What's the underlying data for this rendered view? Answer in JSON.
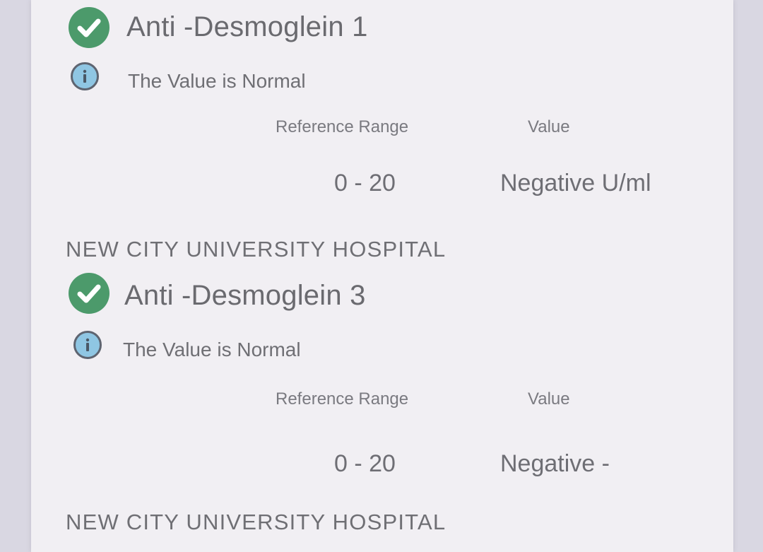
{
  "results": [
    {
      "test_name": "Anti -Desmoglein 1",
      "status_text": "The Value is Normal",
      "reference_range_header": "Reference Range",
      "value_header": "Value",
      "reference_range": "0 - 20",
      "value": "Negative U/ml",
      "lab_name": "NEW CITY UNIVERSITY HOSPITAL",
      "status_icon": "check-circle-icon",
      "info_icon": "info-icon"
    },
    {
      "test_name": "Anti -Desmoglein 3",
      "status_text": "The Value is Normal",
      "reference_range_header": "Reference Range",
      "value_header": "Value",
      "reference_range": "0 - 20",
      "value": "Negative -",
      "lab_name": "NEW CITY UNIVERSITY HOSPITAL",
      "status_icon": "check-circle-icon",
      "info_icon": "info-icon"
    }
  ],
  "colors": {
    "check_green": "#4c9a6b",
    "info_blue": "#8fc6e3",
    "paper": "#f1eff3",
    "background": "#d9d7e2"
  }
}
